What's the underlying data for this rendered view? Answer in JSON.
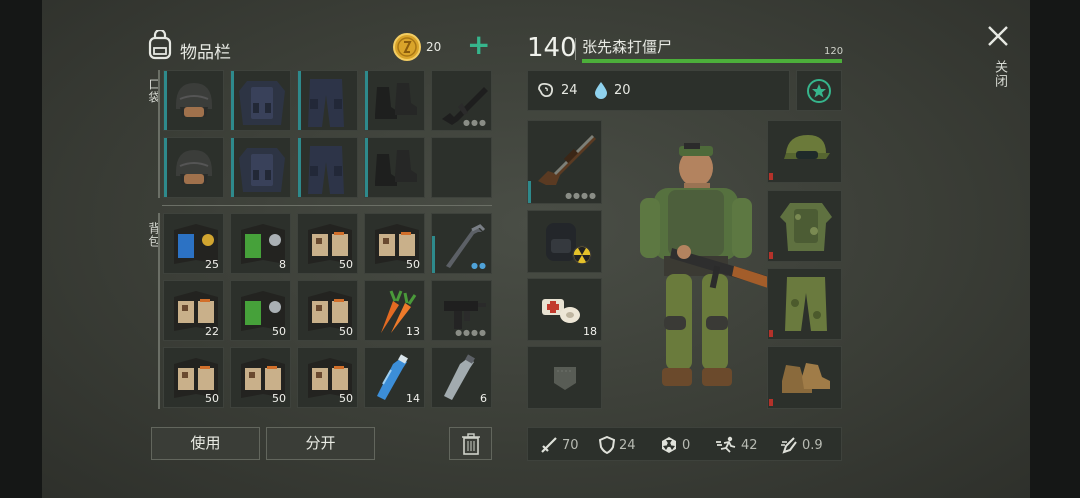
{
  "inventory": {
    "title": "物品栏",
    "coins": "20",
    "add_label": "+",
    "pockets_label": "口袋",
    "backpack_label": "背包",
    "pockets": [
      {
        "name": "helmet-item",
        "count": "",
        "dots": ""
      },
      {
        "name": "vest-item",
        "count": "",
        "dots": ""
      },
      {
        "name": "pants-item",
        "count": "",
        "dots": ""
      },
      {
        "name": "boots-item",
        "count": "",
        "dots": ""
      },
      {
        "name": "rifle-item",
        "count": "",
        "dots": "●●●"
      },
      {
        "name": "helmet-item",
        "count": "",
        "dots": ""
      },
      {
        "name": "vest-item",
        "count": "",
        "dots": ""
      },
      {
        "name": "pants-item",
        "count": "",
        "dots": ""
      },
      {
        "name": "boots-item",
        "count": "",
        "dots": ""
      },
      {
        "name": "empty-slot",
        "count": "",
        "dots": ""
      }
    ],
    "backpack": [
      {
        "name": "blue-book-item",
        "count": "25"
      },
      {
        "name": "green-book-item",
        "count": "8"
      },
      {
        "name": "recipe-book-item",
        "count": "50"
      },
      {
        "name": "recipe-book-item",
        "count": "50"
      },
      {
        "name": "crowbar-item",
        "count": "",
        "dots": "●●"
      },
      {
        "name": "recipe-book-item",
        "count": "22"
      },
      {
        "name": "green-book-item",
        "count": "50"
      },
      {
        "name": "recipe-book-item",
        "count": "50"
      },
      {
        "name": "carrot-item",
        "count": "13"
      },
      {
        "name": "uzi-item",
        "count": "",
        "dots": "●●●●"
      },
      {
        "name": "recipe-book-item",
        "count": "50"
      },
      {
        "name": "recipe-book-item",
        "count": "50"
      },
      {
        "name": "recipe-book-item",
        "count": "50"
      },
      {
        "name": "water-bottle-item",
        "count": "14"
      },
      {
        "name": "empty-bottle-item",
        "count": "6"
      }
    ],
    "use_label": "使用",
    "split_label": "分开"
  },
  "character": {
    "level": "140",
    "name": "张先森打僵尸",
    "xp_max": "120",
    "xp_fraction": 1.0,
    "hunger": "24",
    "thirst": "20",
    "weapon_dots": "●●●●",
    "medkit_count": "18",
    "stats": {
      "attack": "70",
      "defense": "24",
      "radiation": "0",
      "speed": "42",
      "stealth": "0.9"
    }
  },
  "close_label": "关闭",
  "colors": {
    "teal": "#2e8a8c",
    "green": "#4caf3a",
    "red": "#b4322a",
    "accent": "#36b58c"
  }
}
